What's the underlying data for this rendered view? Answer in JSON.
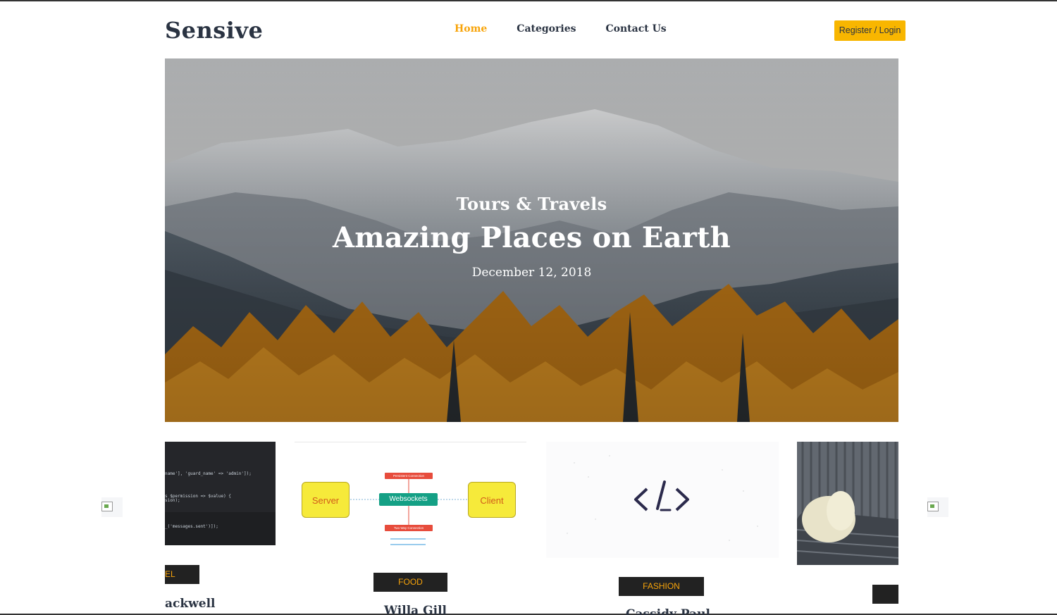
{
  "header": {
    "logo": "Sensive",
    "nav": [
      {
        "label": "Home",
        "active": true
      },
      {
        "label": "Categories",
        "active": false
      },
      {
        "label": "Contact Us",
        "active": false
      }
    ],
    "register_label": "Register / Login"
  },
  "hero": {
    "category": "Tours & Travels",
    "title": "Amazing Places on Earth",
    "date": "December 12, 2018"
  },
  "carousel": {
    "cards": [
      {
        "badge": "EL",
        "author": "ackwell"
      },
      {
        "badge": "FOOD",
        "author": "Willa Gill"
      },
      {
        "badge": "FASHION",
        "author": "Cassidy Paul"
      },
      {
        "badge": "",
        "author": ""
      }
    ],
    "diagram": {
      "server": "Server",
      "websockets": "Websockets",
      "client": "Client",
      "persistent": "Persistent Connection",
      "twoway": "Two Way Connection"
    },
    "code_lines": [
      "name'], 'guard_name' => 'admin']);",
      "s $permission => $value) {",
      "sion);",
      "_('messages.sent')]);"
    ]
  },
  "colors": {
    "accent": "#f8a40a",
    "button": "#f8b600",
    "dark": "#2a3342",
    "badge_bg": "#222222"
  }
}
